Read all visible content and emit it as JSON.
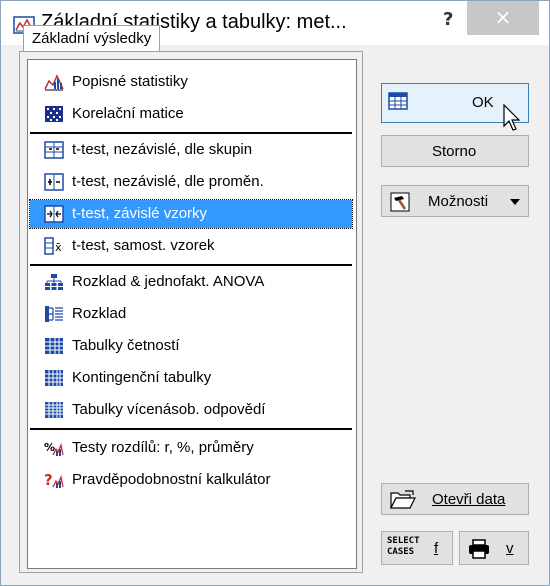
{
  "window": {
    "title": "Základní statistiky a tabulky: met...",
    "help_label": "?",
    "close_label": "×"
  },
  "tab": {
    "label": "Základní výsledky"
  },
  "list": {
    "items": [
      {
        "label": "Popisné statistiky",
        "icon": "descriptive-stats-icon"
      },
      {
        "label": "Korelační matice",
        "icon": "correlation-matrix-icon"
      },
      {
        "label": "t-test, nezávislé, dle skupin",
        "icon": "ttest-groups-icon"
      },
      {
        "label": "t-test, nezávislé, dle proměn.",
        "icon": "ttest-variables-icon"
      },
      {
        "label": "t-test, závislé vzorky",
        "icon": "ttest-dependent-icon",
        "selected": true
      },
      {
        "label": "t-test, samost. vzorek",
        "icon": "ttest-single-sample-icon"
      },
      {
        "label": "Rozklad & jednofakt. ANOVA",
        "icon": "anova-icon"
      },
      {
        "label": "Rozklad",
        "icon": "breakdown-icon"
      },
      {
        "label": "Tabulky četností",
        "icon": "frequency-table-icon"
      },
      {
        "label": "Kontingenční tabulky",
        "icon": "crosstab-icon"
      },
      {
        "label": "Tabulky vícenásob. odpovědí",
        "icon": "multiple-response-icon"
      },
      {
        "label": "Testy rozdílů: r, %, průměry",
        "icon": "difference-tests-icon"
      },
      {
        "label": "Pravděpodobnostní kalkulátor",
        "icon": "probability-calculator-icon"
      }
    ]
  },
  "buttons": {
    "ok": "OK",
    "cancel": "Storno",
    "options": "Možnosti",
    "open_data": "Otevři data",
    "select_cases_text": "SELECT\nCASES",
    "select_cases_key": "f",
    "print_key": "v"
  },
  "colors": {
    "selection": "#3399ff",
    "title_bar": "#ffffff",
    "close_button": "#c7c7c7"
  }
}
